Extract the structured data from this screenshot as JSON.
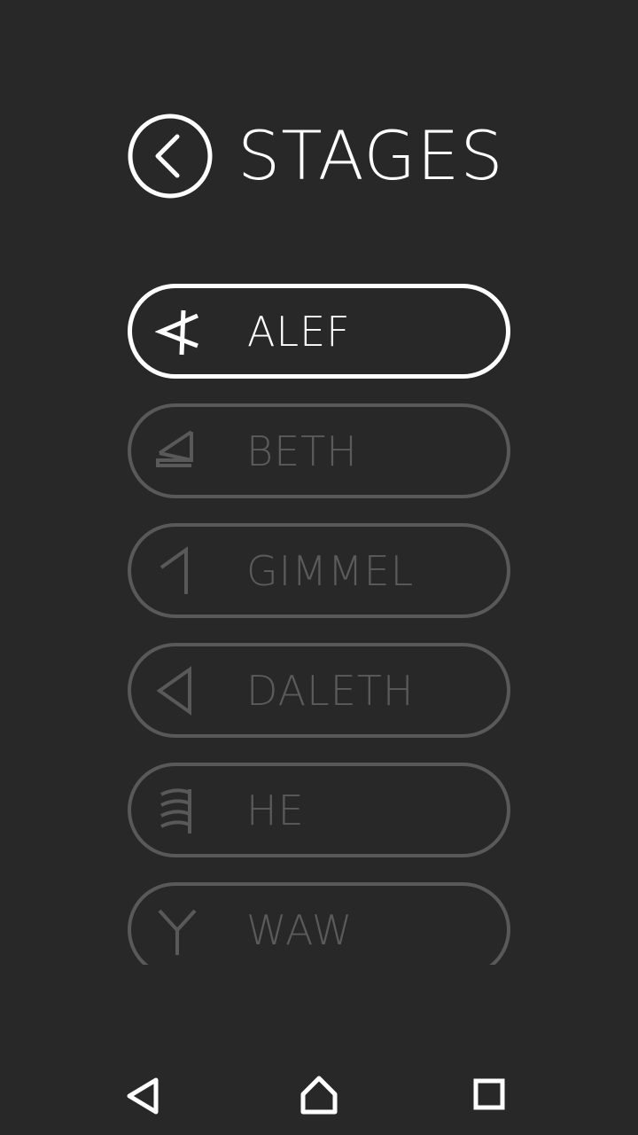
{
  "header": {
    "back_icon": "chevron-left-circle-icon",
    "title": "STAGES"
  },
  "stages": [
    {
      "label": "ALEF",
      "icon": "alef-glyph-icon",
      "active": true
    },
    {
      "label": "BETH",
      "icon": "beth-glyph-icon",
      "active": false
    },
    {
      "label": "GIMMEL",
      "icon": "gimmel-glyph-icon",
      "active": false
    },
    {
      "label": "DALETH",
      "icon": "daleth-glyph-icon",
      "active": false
    },
    {
      "label": "HE",
      "icon": "he-glyph-icon",
      "active": false
    },
    {
      "label": "WAW",
      "icon": "waw-glyph-icon",
      "active": false
    }
  ],
  "navbar": {
    "back_icon": "triangle-back-icon",
    "home_icon": "home-icon",
    "recents_icon": "square-recents-icon"
  },
  "colors": {
    "background": "#282828",
    "active": "#ffffff",
    "inactive": "#595959"
  }
}
